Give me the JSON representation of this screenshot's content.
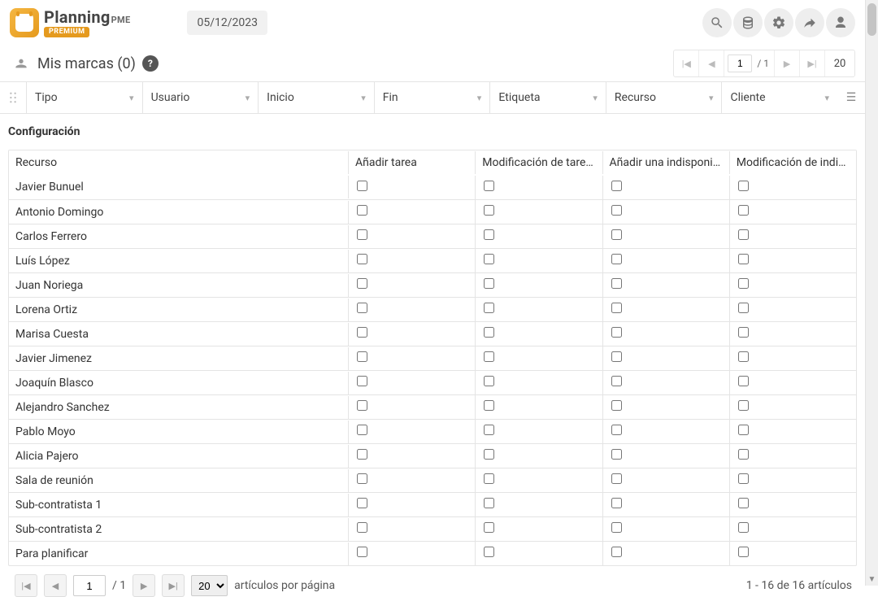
{
  "brand": {
    "name": "Planning",
    "suffix": "PME",
    "tier": "PREMIUM"
  },
  "header": {
    "date": "05/12/2023"
  },
  "subheader": {
    "title": "Mis marcas (0)"
  },
  "pager_top": {
    "current": "1",
    "total": "/ 1",
    "page_size": "20"
  },
  "filters": {
    "tipo": "Tipo",
    "usuario": "Usuario",
    "inicio": "Inicio",
    "fin": "Fin",
    "etiqueta": "Etiqueta",
    "recurso": "Recurso",
    "cliente": "Cliente"
  },
  "config": {
    "title": "Configuración",
    "headers": {
      "recurso": "Recurso",
      "col1": "Añadir tarea",
      "col2": "Modificación de tarea…",
      "col3": "Añadir una indisponib…",
      "col4": "Modificación de indis…"
    },
    "rows": [
      {
        "name": "Javier Bunuel"
      },
      {
        "name": "Antonio Domingo"
      },
      {
        "name": "Carlos Ferrero"
      },
      {
        "name": "Luís López"
      },
      {
        "name": "Juan Noriega"
      },
      {
        "name": "Lorena Ortiz"
      },
      {
        "name": "Marisa Cuesta"
      },
      {
        "name": "Javier Jimenez"
      },
      {
        "name": "Joaquín Blasco"
      },
      {
        "name": "Alejandro Sanchez"
      },
      {
        "name": "Pablo Moyo"
      },
      {
        "name": "Alicia Pajero"
      },
      {
        "name": "Sala de reunión"
      },
      {
        "name": "Sub-contratista 1"
      },
      {
        "name": "Sub-contratista 2"
      },
      {
        "name": "Para planificar"
      }
    ]
  },
  "pager_bottom": {
    "current": "1",
    "total": "/ 1",
    "page_size": "20",
    "per_page_label": "artículos por página",
    "count_label": "1 - 16 de 16 artículos"
  }
}
